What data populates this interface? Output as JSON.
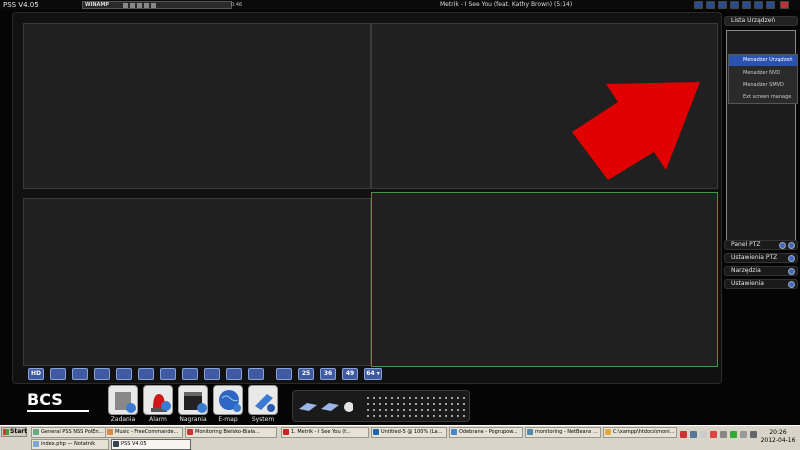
{
  "window": {
    "title": "PSS  V4.05",
    "winamp_logo": "WINAMP",
    "winamp_time": "0:46",
    "track": "Metrik - I See You (feat. Kathy Brown) (5:14)"
  },
  "layout_bar": [
    "HD",
    "",
    "",
    "",
    "",
    "",
    "",
    "",
    "",
    "",
    "",
    "",
    "",
    "25",
    "36",
    "49",
    "64 ▾"
  ],
  "right_panel": {
    "device_list": "Lista Urządzeń",
    "context_menu": [
      "Menadżer Urządzeń",
      "Menadżer NVD",
      "Menadżer SMVD",
      "Ext screen manage"
    ],
    "sections": [
      "Panel PTZ",
      "Ustawienia PTZ",
      "Narzędzia",
      "Ustawienia"
    ]
  },
  "logo": "BCS",
  "modules": [
    {
      "label": "Zadania",
      "icon": "tasks-icon"
    },
    {
      "label": "Alarm",
      "icon": "alarm-siren-icon"
    },
    {
      "label": "Nagrania",
      "icon": "recordings-clapper-icon"
    },
    {
      "label": "E-map",
      "icon": "globe-map-icon"
    },
    {
      "label": "System",
      "icon": "system-tools-icon"
    }
  ],
  "taskbar": {
    "start": "Start",
    "tasks_row1": [
      "General PSS NSS PolEn...",
      "Music - FreeCommande...",
      "Monitoring Bielsko-Biała...",
      "1. Metrik - I See You (f...",
      "Untitled-5 @ 100% (La...",
      "Odebrane - Pogrupow...",
      "monitoring - NetBeans ...",
      "C:\\xampp\\htdocs\\moni..."
    ],
    "tasks_row2": [
      "index.php — Notatnik",
      "PSS V4.05"
    ],
    "clock_time": "20:26",
    "clock_date": "2012-04-16"
  },
  "colors": {
    "accent_blue": "#3f5aa0",
    "active_cell_border": "#3d9c3d",
    "arrow_red": "#e00000"
  }
}
